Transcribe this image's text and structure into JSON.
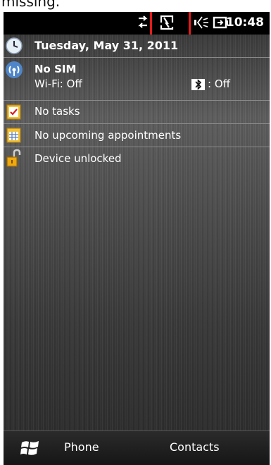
{
  "caption": "missing.",
  "status_bar": {
    "time": "10:48",
    "icons": [
      "sync-arrows-icon",
      "no-sim-icon",
      "volume-icon",
      "battery-charging-icon"
    ]
  },
  "today": {
    "date": "Tuesday, May 31, 2011",
    "sim": {
      "title": "No SIM",
      "wifi": "Wi-Fi: Off",
      "bluetooth": ": Off"
    },
    "tasks": "No tasks",
    "appointments": "No upcoming appointments",
    "device_lock": "Device unlocked"
  },
  "softkeys": {
    "left": "Phone",
    "right": "Contacts"
  },
  "colors": {
    "highlight_box": "#e31b1b",
    "background": "#1c1c1c"
  }
}
